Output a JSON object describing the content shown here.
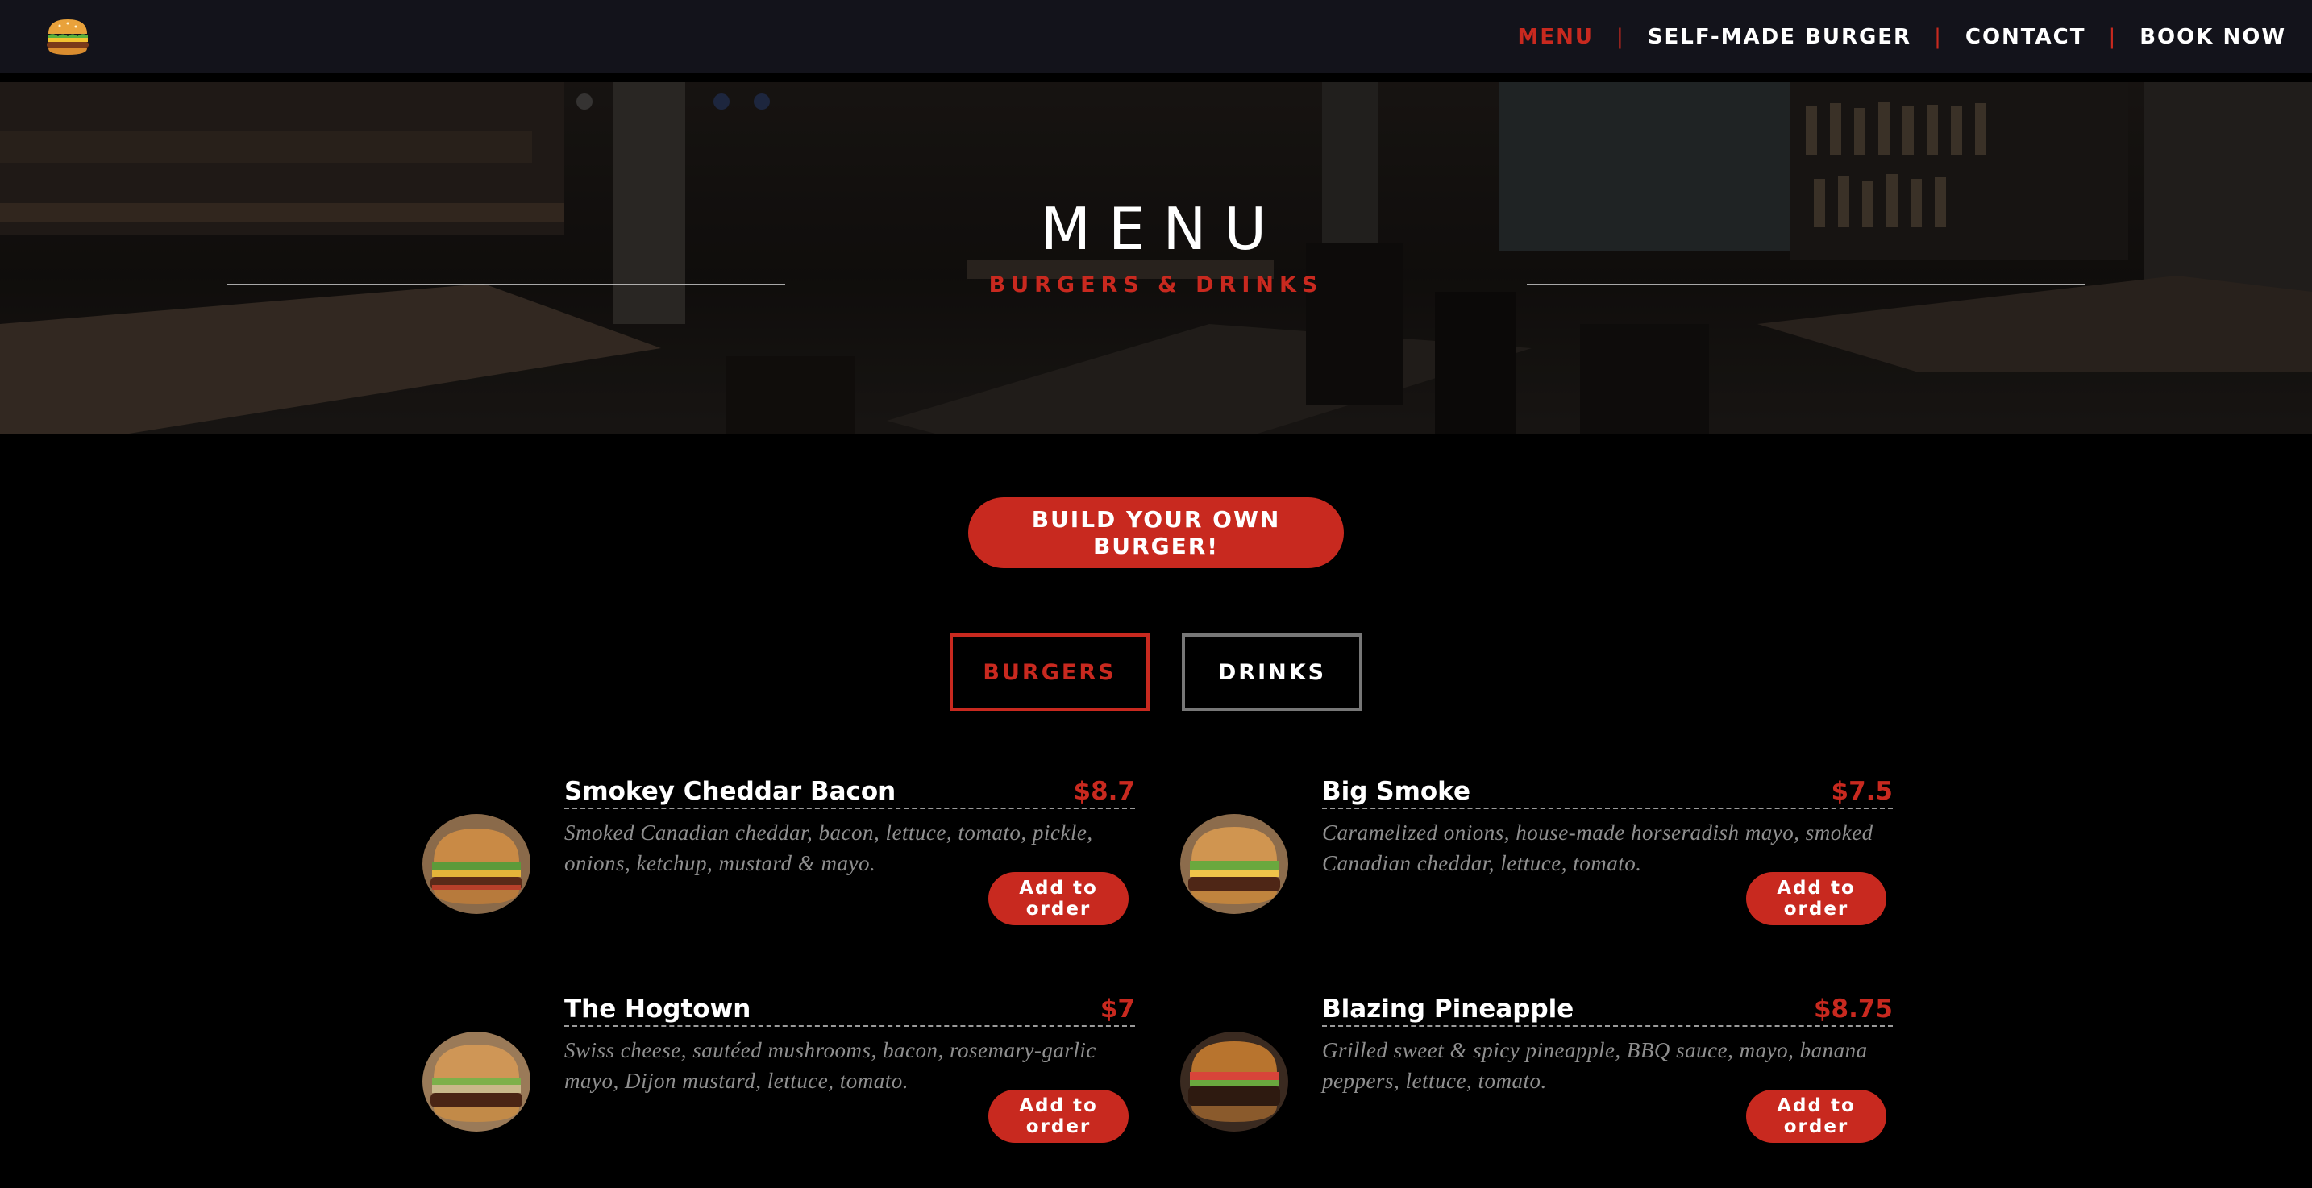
{
  "nav": {
    "logo_icon": "burger-icon",
    "links": [
      {
        "label": "MENU"
      },
      {
        "label": "SELF-MADE BURGER"
      },
      {
        "label": "CONTACT"
      },
      {
        "label": "BOOK NOW"
      }
    ],
    "separator": "|"
  },
  "hero": {
    "title": "MENU",
    "subtitle": "BURGERS & DRINKS"
  },
  "main": {
    "build_button": "BUILD YOUR OWN BURGER!",
    "tabs": [
      {
        "label": "BURGERS",
        "active": true
      },
      {
        "label": "DRINKS",
        "active": false
      }
    ]
  },
  "items": [
    {
      "name": "Smokey Cheddar Bacon",
      "price": "$8.7",
      "description": "Smoked Canadian cheddar, bacon, lettuce, tomato, pickle, onions, ketchup, mustard & mayo.",
      "button": "Add to order"
    },
    {
      "name": "Big Smoke",
      "price": "$7.5",
      "description": "Caramelized onions, house-made horseradish mayo, smoked Canadian cheddar, lettuce, tomato.",
      "button": "Add to order"
    },
    {
      "name": "The Hogtown",
      "price": "$7",
      "description": "Swiss cheese, sautéed mushrooms, bacon, rosemary-garlic mayo, Dijon mustard, lettuce, tomato.",
      "button": "Add to order"
    },
    {
      "name": "Blazing Pineapple",
      "price": "$8.75",
      "description": "Grilled sweet & spicy pineapple, BBQ sauce, mayo, banana peppers, lettuce, tomato.",
      "button": "Add to order"
    }
  ],
  "colors": {
    "accent": "#c8291f",
    "nav_bg": "#13131b",
    "page_bg": "#000000",
    "muted_text": "#8f8f8f"
  }
}
